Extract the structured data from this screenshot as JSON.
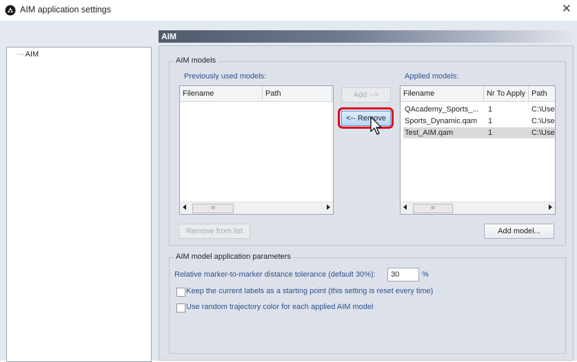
{
  "window": {
    "title": "AIM application settings",
    "close_glyph": "✕"
  },
  "tree": {
    "items": [
      {
        "label": "AIM"
      }
    ]
  },
  "header": {
    "title": "AIM"
  },
  "aim_models": {
    "group_title": "AIM models",
    "previous_label": "Previously used models:",
    "applied_label": "Applied models:",
    "previous_columns": [
      "Filename",
      "Path"
    ],
    "applied_columns": [
      "Filename",
      "Nr To Apply",
      "Path"
    ],
    "applied_rows": [
      {
        "filename": "QAcademy_Sports_...",
        "nr": "1",
        "path": "C:\\Use"
      },
      {
        "filename": "Sports_Dynamic.qam",
        "nr": "1",
        "path": "C:\\Use"
      },
      {
        "filename": "Test_AIM.qam",
        "nr": "1",
        "path": "C:\\Use"
      }
    ],
    "add_button": "Add -->",
    "remove_button": "<-- Remove",
    "remove_from_list_button": "Remove from list",
    "add_model_button": "Add model...",
    "scroll_thumb": "III"
  },
  "params": {
    "group_title": "AIM model application parameters",
    "tolerance_label": "Relative marker-to-marker distance tolerance (default 30%):",
    "tolerance_value": "30",
    "tolerance_unit": "%",
    "keep_labels": "Keep the current labels as a starting point (this setting is reset every time)",
    "random_color": "Use random trajectory color for each applied AIM model"
  },
  "colors": {
    "highlight": "#e3001b",
    "selection": "#d9d9d9",
    "header_start": "#515a6b"
  },
  "icons": {
    "app": "aim-app-icon",
    "close": "close-icon",
    "cursor": "mouse-pointer-icon"
  }
}
